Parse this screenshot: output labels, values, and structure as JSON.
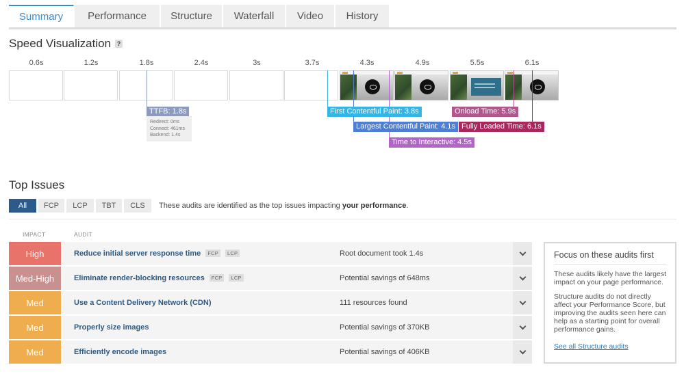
{
  "tabs": [
    "Summary",
    "Performance",
    "Structure",
    "Waterfall",
    "Video",
    "History"
  ],
  "speed": {
    "title": "Speed Visualization",
    "help": "?",
    "ticks": [
      "0.6s",
      "1.2s",
      "1.8s",
      "2.4s",
      "3s",
      "3.7s",
      "4.3s",
      "4.9s",
      "5.5s",
      "6.1s"
    ],
    "markers": {
      "ttfb": "TTFB: 1.8s",
      "ttfb_detail": [
        "Redirect: 0ms",
        "Connect: 461ms",
        "Backend: 1.4s"
      ],
      "fcp": "First Contentful Paint: 3.8s",
      "lcp": "Largest Contentful Paint: 4.1s",
      "tti": "Time to Interactive: 4.5s",
      "onload": "Onload Time: 5.9s",
      "fully_loaded": "Fully Loaded Time: 6.1s"
    },
    "colors": {
      "ttfb": "#8c9ac0",
      "fcp": "#35b5e5",
      "lcp": "#4f7fd1",
      "tti": "#b065c7",
      "onload": "#b0578c",
      "fully_loaded": "#a8285e"
    }
  },
  "issues": {
    "title": "Top Issues",
    "filters": [
      "All",
      "FCP",
      "LCP",
      "TBT",
      "CLS"
    ],
    "note_prefix": "These audits are identified as the top issues impacting",
    "note_bold": "your performance",
    "note_suffix": ".",
    "col_impact": "IMPACT",
    "col_audit": "AUDIT",
    "rows": [
      {
        "impact": "High",
        "audit": "Reduce initial server response time",
        "tags": [
          "FCP",
          "LCP"
        ],
        "result": "Root document took 1.4s",
        "color": "#e8736a"
      },
      {
        "impact": "Med-High",
        "audit": "Eliminate render-blocking resources",
        "tags": [
          "FCP",
          "LCP"
        ],
        "result": "Potential savings of 648ms",
        "color": "#c99090"
      },
      {
        "impact": "Med",
        "audit": "Use a Content Delivery Network (CDN)",
        "tags": [],
        "result": "111 resources found",
        "color": "#f0ad4e"
      },
      {
        "impact": "Med",
        "audit": "Properly size images",
        "tags": [],
        "result": "Potential savings of 370KB",
        "color": "#f0ad4e"
      },
      {
        "impact": "Med",
        "audit": "Efficiently encode images",
        "tags": [],
        "result": "Potential savings of 406KB",
        "color": "#f0ad4e"
      }
    ]
  },
  "focus": {
    "title": "Focus on these audits first",
    "p1": "These audits likely have the largest impact on your page performance.",
    "p2": "Structure audits do not directly affect your Performance Score, but improving the audits seen here can help as a starting point for overall performance gains.",
    "link": "See all Structure audits"
  }
}
